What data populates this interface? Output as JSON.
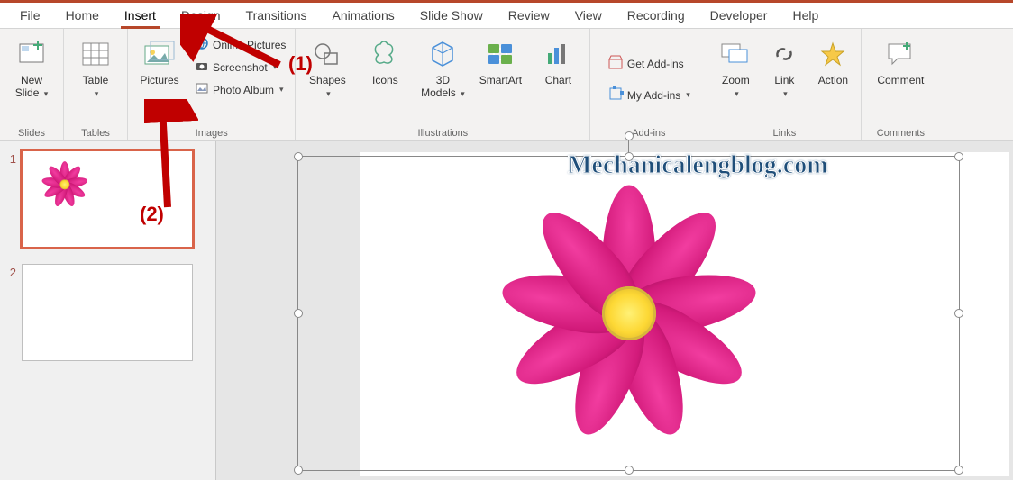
{
  "menubar": {
    "tabs": [
      "File",
      "Home",
      "Insert",
      "Design",
      "Transitions",
      "Animations",
      "Slide Show",
      "Review",
      "View",
      "Recording",
      "Developer",
      "Help"
    ],
    "active": "Insert"
  },
  "ribbon": {
    "groups": {
      "slides": {
        "label": "Slides",
        "newSlide": "New Slide"
      },
      "tables": {
        "label": "Tables",
        "table": "Table"
      },
      "images": {
        "label": "Images",
        "pictures": "Pictures",
        "onlinePictures": "Online Pictures",
        "screenshot": "Screenshot",
        "photoAlbum": "Photo Album"
      },
      "illustrations": {
        "label": "Illustrations",
        "shapes": "Shapes",
        "icons": "Icons",
        "models3d": "3D Models",
        "smartart": "SmartArt",
        "chart": "Chart"
      },
      "addins": {
        "label": "Add-ins",
        "getAddins": "Get Add-ins",
        "myAddins": "My Add-ins"
      },
      "links": {
        "label": "Links",
        "zoom": "Zoom",
        "link": "Link",
        "action": "Action"
      },
      "comments": {
        "label": "Comments",
        "comment": "Comment"
      }
    }
  },
  "slidePanel": {
    "slides": [
      {
        "number": "1",
        "selected": true,
        "hasFlower": true
      },
      {
        "number": "2",
        "selected": false,
        "hasFlower": false
      }
    ]
  },
  "annotations": {
    "a1": "(1)",
    "a2": "(2)"
  },
  "watermark": "Mechanicalengblog.com",
  "canvas": {
    "imageDescription": "pink cosmos flower",
    "selected": true
  }
}
